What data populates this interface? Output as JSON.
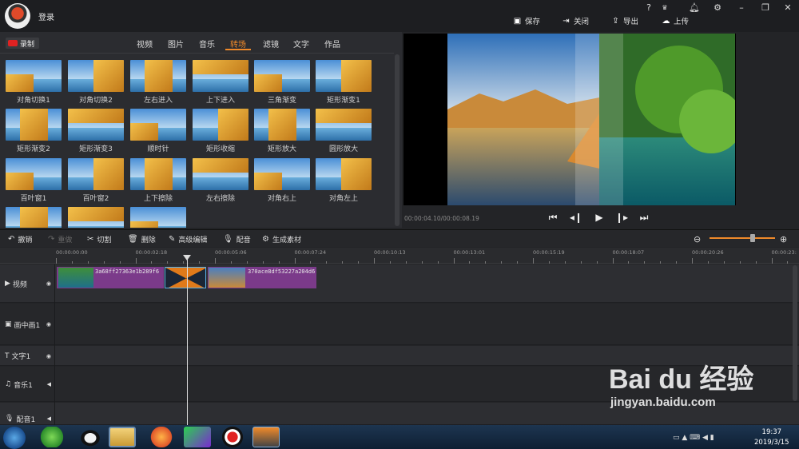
{
  "titlebar": {
    "login_label": "登录",
    "window_controls": [
      "?",
      "VIP",
      "bell",
      "gear",
      "minimize",
      "restore",
      "close"
    ],
    "actions": [
      {
        "label": "保存",
        "icon": "save-icon"
      },
      {
        "label": "关闭",
        "icon": "exit-icon"
      },
      {
        "label": "导出",
        "icon": "export-icon"
      },
      {
        "label": "上传",
        "icon": "upload-icon"
      }
    ]
  },
  "library": {
    "record_label": "录制",
    "tabs": [
      "视频",
      "图片",
      "音乐",
      "转场",
      "滤镜",
      "文字",
      "作品"
    ],
    "active_tab": "转场",
    "items": [
      "对角切换1",
      "对角切换2",
      "左右进入",
      "上下进入",
      "三角渐变",
      "矩形渐变1",
      "矩形渐变2",
      "矩形渐变3",
      "顺时针",
      "矩形收缩",
      "矩形放大",
      "圆形放大",
      "百叶窗1",
      "百叶窗2",
      "上下擦除",
      "左右擦除",
      "对角右上",
      "对角左上",
      "",
      "",
      ""
    ]
  },
  "preview": {
    "time": "00:00:04.10/00:00:08.19"
  },
  "toolbar": {
    "undo": "撤销",
    "redo": "重做",
    "cut": "切割",
    "delete": "删除",
    "advanced_edit": "高级编辑",
    "dub": "配音",
    "generate": "生成素材"
  },
  "timeline": {
    "ticks": [
      "00:00:00:00",
      "00:00:02:18",
      "00:00:05:06",
      "00:00:07:24",
      "00:00:10:13",
      "00:00:13:01",
      "00:00:15:19",
      "00:00:18:07",
      "00:00:20:26",
      "00:00:23:"
    ],
    "tracks": [
      {
        "label": "视频",
        "icon": "play-icon"
      },
      {
        "label": "画中画1",
        "icon": "pip-icon"
      },
      {
        "label": "文字1",
        "icon": "text-icon"
      },
      {
        "label": "音乐1",
        "icon": "music-icon"
      },
      {
        "label": "配音1",
        "icon": "mic-icon"
      }
    ],
    "clips": [
      {
        "name": "3a68ff27363e1b289f6"
      },
      {
        "name": "370ace8df53227a204d6"
      }
    ]
  },
  "taskbar": {
    "time": "19:37",
    "date": "2019/3/15"
  },
  "watermark": {
    "brand": "Bai du 经验",
    "url": "jingyan.baidu.com"
  }
}
